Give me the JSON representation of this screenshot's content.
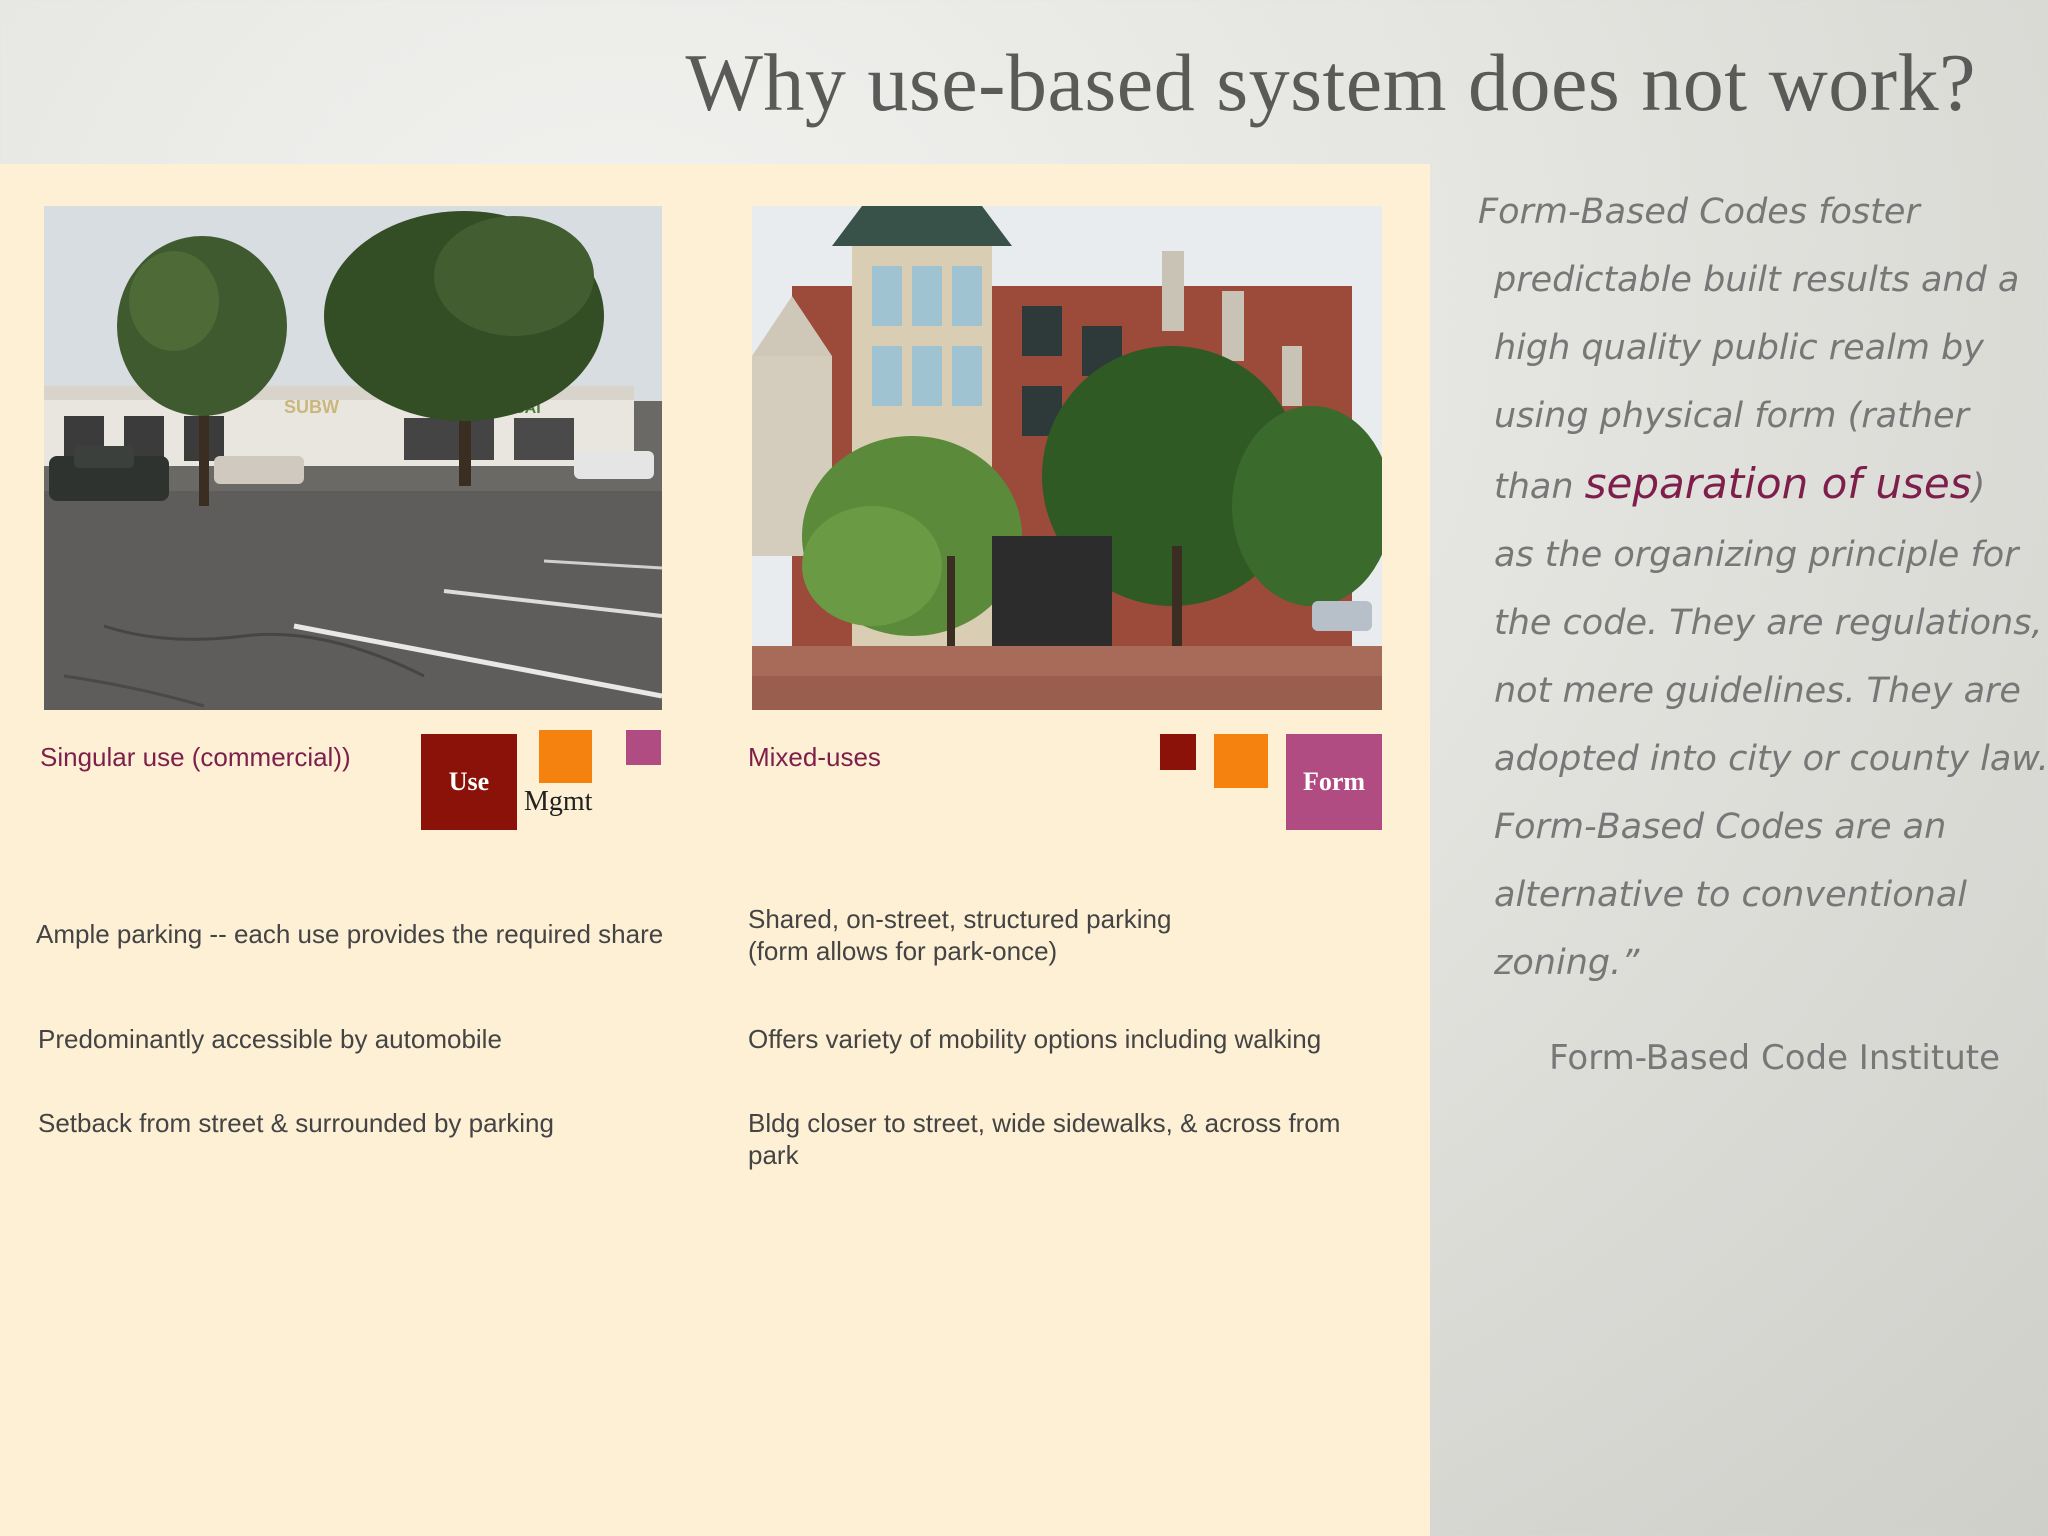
{
  "slide": {
    "title": "Why use-based system does not work?"
  },
  "left": {
    "caption": "Singular use  (commercial))",
    "squares": {
      "use": "Use",
      "mgmt": "Mgmt"
    },
    "points": [
      "Ample parking -- each use provides the required share",
      "Predominantly accessible by automobile",
      "Setback from street & surrounded by parking"
    ]
  },
  "right": {
    "caption": "Mixed-uses",
    "squares": {
      "form": "Form"
    },
    "points": [
      "Shared, on-street, structured parking (form allows for park-once)",
      "Offers variety of mobility options including walking",
      "Bldg closer to street, wide sidewalks, & across from park"
    ]
  },
  "quote": {
    "line1": "Form-Based Codes foster",
    "line2": "predictable built results and a",
    "line3": "high quality public realm by",
    "line4": "using physical form (rather",
    "line5_pre": "than ",
    "line5_highlight": "separation of uses",
    "line5_post": ")",
    "line6": "as the organizing principle for",
    "line7": "the code. They are regulations,",
    "line8": "not mere guidelines. They are",
    "line9": "adopted into city or county law.",
    "line10": "Form-Based Codes are an",
    "line11": "alternative to conventional",
    "line12": "zoning.”",
    "source": "Form-Based Code Institute"
  },
  "colors": {
    "use": "#8b1208",
    "mgmt": "#f5820f",
    "form": "#b04c82",
    "accent": "#7e1f4b"
  },
  "images": {
    "strip_mall_signs": [
      "SUBW",
      "SAI"
    ]
  }
}
